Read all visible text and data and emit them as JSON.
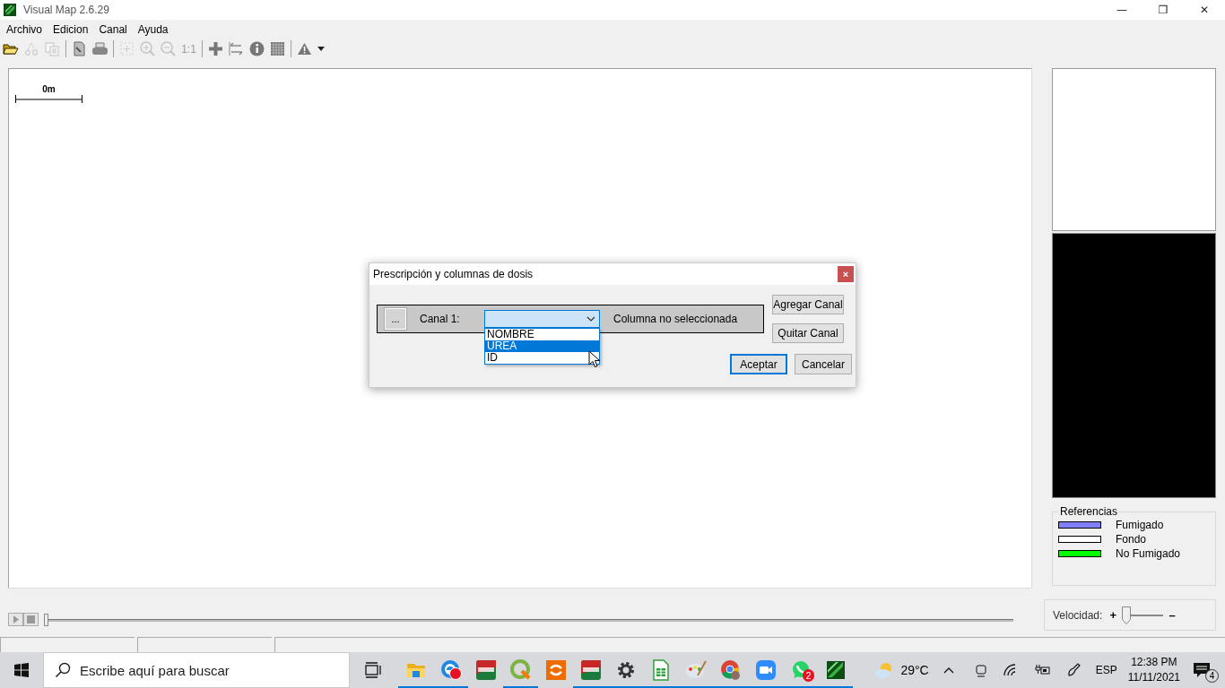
{
  "window": {
    "title": "Visual Map 2.6.29",
    "controls": [
      "—",
      "❐",
      "✕"
    ]
  },
  "menu": [
    "Archivo",
    "Edicion",
    "Canal",
    "Ayuda"
  ],
  "toolbar": [
    {
      "kind": "button",
      "disabled": false
    },
    {
      "kind": "button",
      "disabled": true
    },
    {
      "kind": "button",
      "disabled": true
    },
    {
      "kind": "separator"
    },
    {
      "kind": "button",
      "disabled": false
    },
    {
      "kind": "button",
      "disabled": false
    },
    {
      "kind": "separator"
    },
    {
      "kind": "button",
      "disabled": true
    },
    {
      "kind": "button",
      "disabled": true
    },
    {
      "kind": "button",
      "disabled": true
    },
    {
      "kind": "label",
      "text": "1:1",
      "disabled": true
    },
    {
      "kind": "separator"
    },
    {
      "kind": "button",
      "disabled": false
    },
    {
      "kind": "button",
      "disabled": false
    },
    {
      "kind": "button",
      "disabled": false
    },
    {
      "kind": "button",
      "disabled": false
    },
    {
      "kind": "separator"
    },
    {
      "kind": "button",
      "disabled": false
    },
    {
      "kind": "dropdown",
      "disabled": false
    }
  ],
  "map": {
    "scale_label": "0m"
  },
  "dialog": {
    "title": "Prescripción y columnas de dosis",
    "close": "×",
    "channels": [
      {
        "browse": "...",
        "label": "Canal 1:",
        "expanded": true,
        "status": "Columna no seleccionada",
        "options": [
          {
            "label": "NOMBRE",
            "selected": false
          },
          {
            "label": "UREA",
            "selected": true
          },
          {
            "label": "ID",
            "selected": false
          }
        ]
      }
    ],
    "side_buttons": [
      "Agregar Canal",
      "Quitar Canal"
    ],
    "buttons": [
      {
        "label": "Aceptar",
        "default": true
      },
      {
        "label": "Cancelar",
        "default": false
      }
    ]
  },
  "legend": {
    "title": "Referencias",
    "items": [
      {
        "label": "Fumigado",
        "color": "#8080ff"
      },
      {
        "label": "Fondo",
        "color": "#ffffff"
      },
      {
        "label": "No Fumigado",
        "color": "#00ff00"
      }
    ]
  },
  "playback": {
    "level": 0
  },
  "speed": {
    "label": "Velocidad:",
    "plus": "+",
    "minus": "–",
    "level": 0
  },
  "taskbar": {
    "search": {
      "placeholder": "Escribe aquí para buscar"
    },
    "apps": [
      {
        "running": true,
        "alert": false
      },
      {
        "running": true,
        "alert": true
      },
      {
        "running": false,
        "alert": false
      },
      {
        "running": true,
        "alert": false
      },
      {
        "running": false,
        "alert": false
      },
      {
        "running": true,
        "alert": false
      },
      {
        "running": true,
        "alert": false
      },
      {
        "running": true,
        "alert": false
      },
      {
        "running": true,
        "alert": false
      },
      {
        "running": true,
        "alert": false
      },
      {
        "running": true,
        "alert": false
      },
      {
        "running": true,
        "alert": false,
        "badge": "2"
      },
      {
        "running": true,
        "alert": false
      }
    ],
    "temperature": "29°C",
    "language": "ESP",
    "time": "12:38 PM",
    "date": "11/11/2021",
    "notifications": "4"
  }
}
